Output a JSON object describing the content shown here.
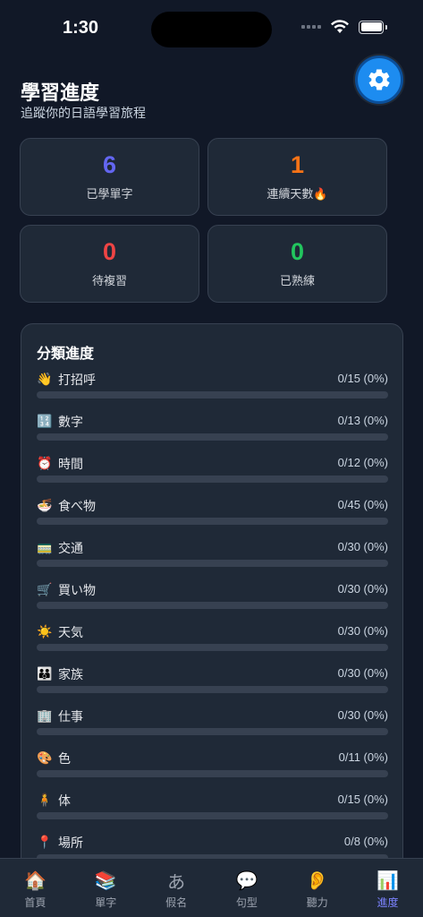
{
  "status": {
    "time": "1:30"
  },
  "header": {
    "title": "學習進度",
    "subtitle": "追蹤你的日語學習旅程"
  },
  "stats": [
    {
      "value": "6",
      "label": "已學單字",
      "color": "#6366f1"
    },
    {
      "value": "1",
      "label": "連續天數🔥",
      "color": "#f97316"
    },
    {
      "value": "0",
      "label": "待複習",
      "color": "#ef4444"
    },
    {
      "value": "0",
      "label": "已熟練",
      "color": "#22c55e"
    }
  ],
  "categories_panel": {
    "title": "分類進度",
    "items": [
      {
        "emoji": "👋",
        "label": "打招呼",
        "count": "0/15 (0%)",
        "progress": 0
      },
      {
        "emoji": "🔢",
        "label": "數字",
        "count": "0/13 (0%)",
        "progress": 0
      },
      {
        "emoji": "⏰",
        "label": "時間",
        "count": "0/12 (0%)",
        "progress": 0
      },
      {
        "emoji": "🍜",
        "label": "食べ物",
        "count": "0/45 (0%)",
        "progress": 0
      },
      {
        "emoji": "🚃",
        "label": "交通",
        "count": "0/30 (0%)",
        "progress": 0
      },
      {
        "emoji": "🛒",
        "label": "買い物",
        "count": "0/30 (0%)",
        "progress": 0
      },
      {
        "emoji": "☀️",
        "label": "天気",
        "count": "0/30 (0%)",
        "progress": 0
      },
      {
        "emoji": "👪",
        "label": "家族",
        "count": "0/30 (0%)",
        "progress": 0
      },
      {
        "emoji": "🏢",
        "label": "仕事",
        "count": "0/30 (0%)",
        "progress": 0
      },
      {
        "emoji": "🎨",
        "label": "色",
        "count": "0/11 (0%)",
        "progress": 0
      },
      {
        "emoji": "🧍",
        "label": "体",
        "count": "0/15 (0%)",
        "progress": 0
      },
      {
        "emoji": "📍",
        "label": "場所",
        "count": "0/8 (0%)",
        "progress": 0
      }
    ]
  },
  "tabs": [
    {
      "icon": "🏠",
      "label": "首頁",
      "active": false
    },
    {
      "icon": "📚",
      "label": "單字",
      "active": false
    },
    {
      "icon": "あ",
      "label": "假名",
      "active": false
    },
    {
      "icon": "💬",
      "label": "句型",
      "active": false
    },
    {
      "icon": "👂",
      "label": "聽力",
      "active": false
    },
    {
      "icon": "📊",
      "label": "進度",
      "active": true
    }
  ],
  "accent_color": "#7c83ff"
}
